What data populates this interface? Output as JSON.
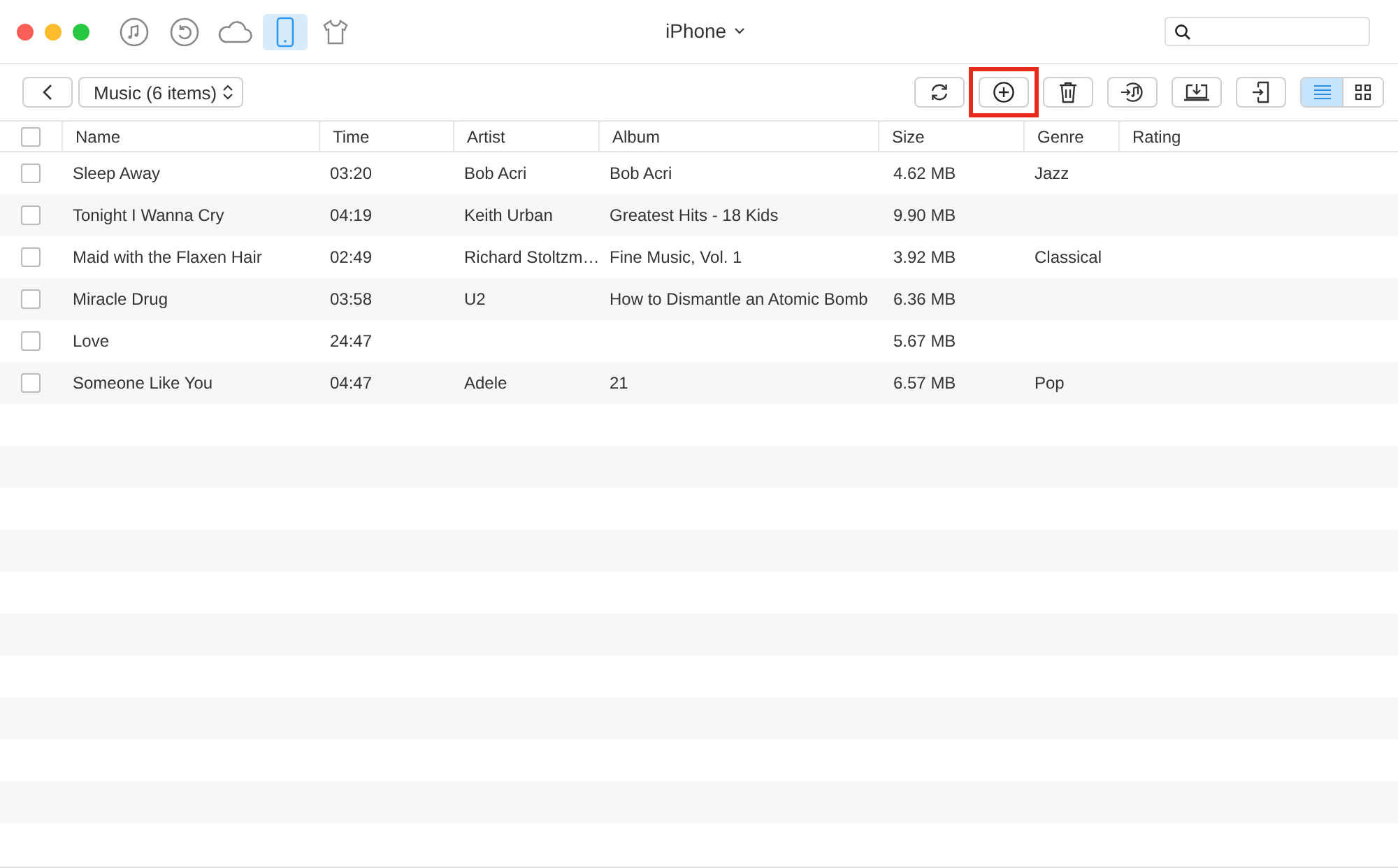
{
  "window": {
    "title": "iPhone"
  },
  "nav_icons": [
    {
      "kind": "music",
      "selected": false
    },
    {
      "kind": "restore",
      "selected": false
    },
    {
      "kind": "cloud",
      "selected": false
    },
    {
      "kind": "phone",
      "selected": true
    },
    {
      "kind": "shirt",
      "selected": false
    }
  ],
  "category": {
    "label": "Music (6 items)"
  },
  "toolbar": [
    {
      "kind": "refresh",
      "highlighted": false
    },
    {
      "kind": "add",
      "highlighted": true
    },
    {
      "kind": "delete",
      "highlighted": false
    },
    {
      "kind": "to-itunes",
      "highlighted": false
    },
    {
      "kind": "to-computer",
      "highlighted": false
    },
    {
      "kind": "to-device",
      "highlighted": false
    }
  ],
  "view_toggle": [
    {
      "kind": "list",
      "selected": true
    },
    {
      "kind": "grid",
      "selected": false
    }
  ],
  "table": {
    "all_checked": false,
    "columns": [
      "Name",
      "Time",
      "Artist",
      "Album",
      "Size",
      "Genre",
      "Rating"
    ],
    "rows": [
      {
        "checked": false,
        "cells": [
          "Sleep Away",
          "03:20",
          "Bob Acri",
          "Bob Acri",
          "4.62 MB",
          "Jazz"
        ]
      },
      {
        "checked": false,
        "cells": [
          "Tonight I Wanna Cry",
          "04:19",
          "Keith Urban",
          "Greatest Hits - 18 Kids",
          "9.90 MB",
          ""
        ]
      },
      {
        "checked": false,
        "cells": [
          "Maid with the Flaxen Hair",
          "02:49",
          "Richard Stoltzm…",
          "Fine Music, Vol. 1",
          "3.92 MB",
          "Classical"
        ]
      },
      {
        "checked": false,
        "cells": [
          "Miracle Drug",
          "03:58",
          "U2",
          "How to Dismantle an Atomic Bomb",
          "6.36 MB",
          ""
        ]
      },
      {
        "checked": false,
        "cells": [
          "Love",
          "24:47",
          "",
          "",
          "5.67 MB",
          ""
        ]
      },
      {
        "checked": false,
        "cells": [
          "Someone Like You",
          "04:47",
          "Adele",
          "21",
          "6.57 MB",
          "Pop"
        ]
      }
    ]
  }
}
